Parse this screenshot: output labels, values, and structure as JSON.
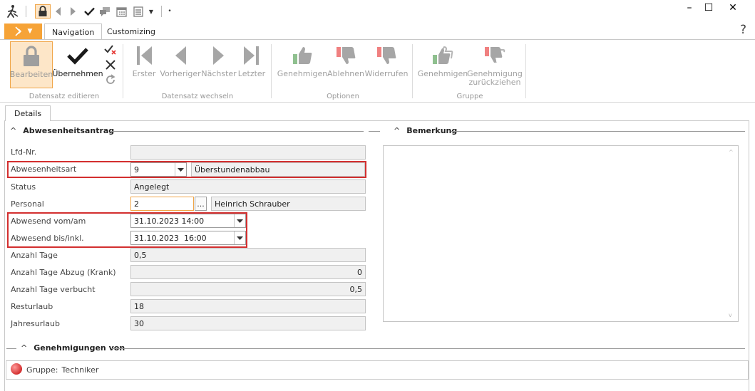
{
  "window": {
    "controls": {
      "minimize": "–",
      "maximize": "☐",
      "close": "✕"
    }
  },
  "ribbon": {
    "file_tab_label": "",
    "tabs": [
      {
        "label": "Navigation",
        "active": true
      },
      {
        "label": "Customizing",
        "active": false
      }
    ],
    "help": "?",
    "groups": [
      {
        "label": "Datensatz editieren",
        "buttons": [
          {
            "label": "Bearbeiten",
            "icon": "lock-icon",
            "state": "selected"
          },
          {
            "label": "Übernehmen",
            "icon": "check-icon",
            "state": "enabled"
          }
        ]
      },
      {
        "label": "Datensatz wechseln",
        "buttons": [
          {
            "label": "Erster",
            "icon": "first-icon"
          },
          {
            "label": "Vorheriger",
            "icon": "previous-icon"
          },
          {
            "label": "Nächster",
            "icon": "next-icon"
          },
          {
            "label": "Letzter",
            "icon": "last-icon"
          }
        ]
      },
      {
        "label": "Optionen",
        "buttons": [
          {
            "label": "Genehmigen",
            "icon": "thumbs-up-icon"
          },
          {
            "label": "Ablehnen",
            "icon": "thumbs-down-icon"
          },
          {
            "label": "Widerrufen",
            "icon": "thumbs-down-icon"
          }
        ]
      },
      {
        "label": "Gruppe",
        "buttons": [
          {
            "label": "Genehmigen",
            "icon": "group-thumbs-up-icon"
          },
          {
            "label": "Genehmigung\nzurückziehen",
            "label_line1": "Genehmigung",
            "label_line2": "zurückziehen",
            "icon": "group-thumbs-down-icon"
          }
        ]
      }
    ]
  },
  "content": {
    "tab_label": "Details",
    "section_request": {
      "title": "Abwesenheitsantrag",
      "fields": {
        "lfd_nr": {
          "label": "Lfd-Nr.",
          "value": ""
        },
        "abwesenheitsart": {
          "label": "Abwesenheitsart",
          "code": "9",
          "text": "Überstundenabbau"
        },
        "status": {
          "label": "Status",
          "value": "Angelegt"
        },
        "personal": {
          "label": "Personal",
          "code": "2",
          "button": "...",
          "name": "Heinrich Schrauber"
        },
        "abwesend_von": {
          "label": "Abwesend vom/am",
          "value": "31.10.2023 14:00"
        },
        "abwesend_bis": {
          "label": "Abwesend bis/inkl.",
          "value": "31.10.2023  16:00"
        },
        "anzahl_tage": {
          "label": "Anzahl Tage",
          "value": "0,5"
        },
        "anzahl_tage_abzug": {
          "label": "Anzahl Tage Abzug (Krank)",
          "value": "0"
        },
        "anzahl_tage_verbucht": {
          "label": "Anzahl Tage verbucht",
          "value": "0,5"
        },
        "resturlaub": {
          "label": "Resturlaub",
          "value": "18"
        },
        "jahresurlaub": {
          "label": "Jahresurlaub",
          "value": "30"
        }
      }
    },
    "section_remark": {
      "title": "Bemerkung",
      "text": ""
    },
    "section_approvals": {
      "title": "Genehmigungen von",
      "entries": [
        {
          "prefix": "Gruppe:",
          "value": "Techniker"
        }
      ]
    }
  },
  "colors": {
    "accent_orange": "#f6a337",
    "highlight_red": "#d32f2f",
    "status_red": "#e53935"
  }
}
